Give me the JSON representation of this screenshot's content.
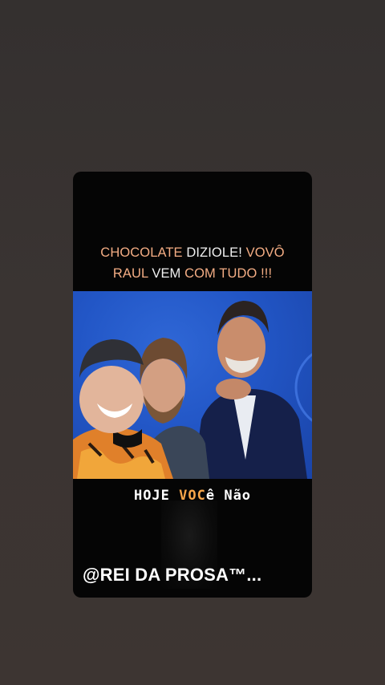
{
  "story": {
    "headline": {
      "line1": [
        {
          "text": "CHOCOLATE",
          "highlight": true
        },
        {
          "text": " DIZIOLE! ",
          "highlight": false
        },
        {
          "text": "VOVÔ",
          "highlight": true
        }
      ],
      "line2": [
        {
          "text": "RAUL",
          "highlight": true
        },
        {
          "text": " VEM ",
          "highlight": false
        },
        {
          "text": "COM TUDO !!!",
          "highlight": true
        }
      ]
    },
    "caption": {
      "part1": "HOJE ",
      "part2": "VOC",
      "part3": "ê Não"
    },
    "watermark": "@REI DA PROSA™..."
  },
  "colors": {
    "highlight": "#f4ad84",
    "caption_highlight": "#f7a64a",
    "photo_background": "#2256c6"
  }
}
